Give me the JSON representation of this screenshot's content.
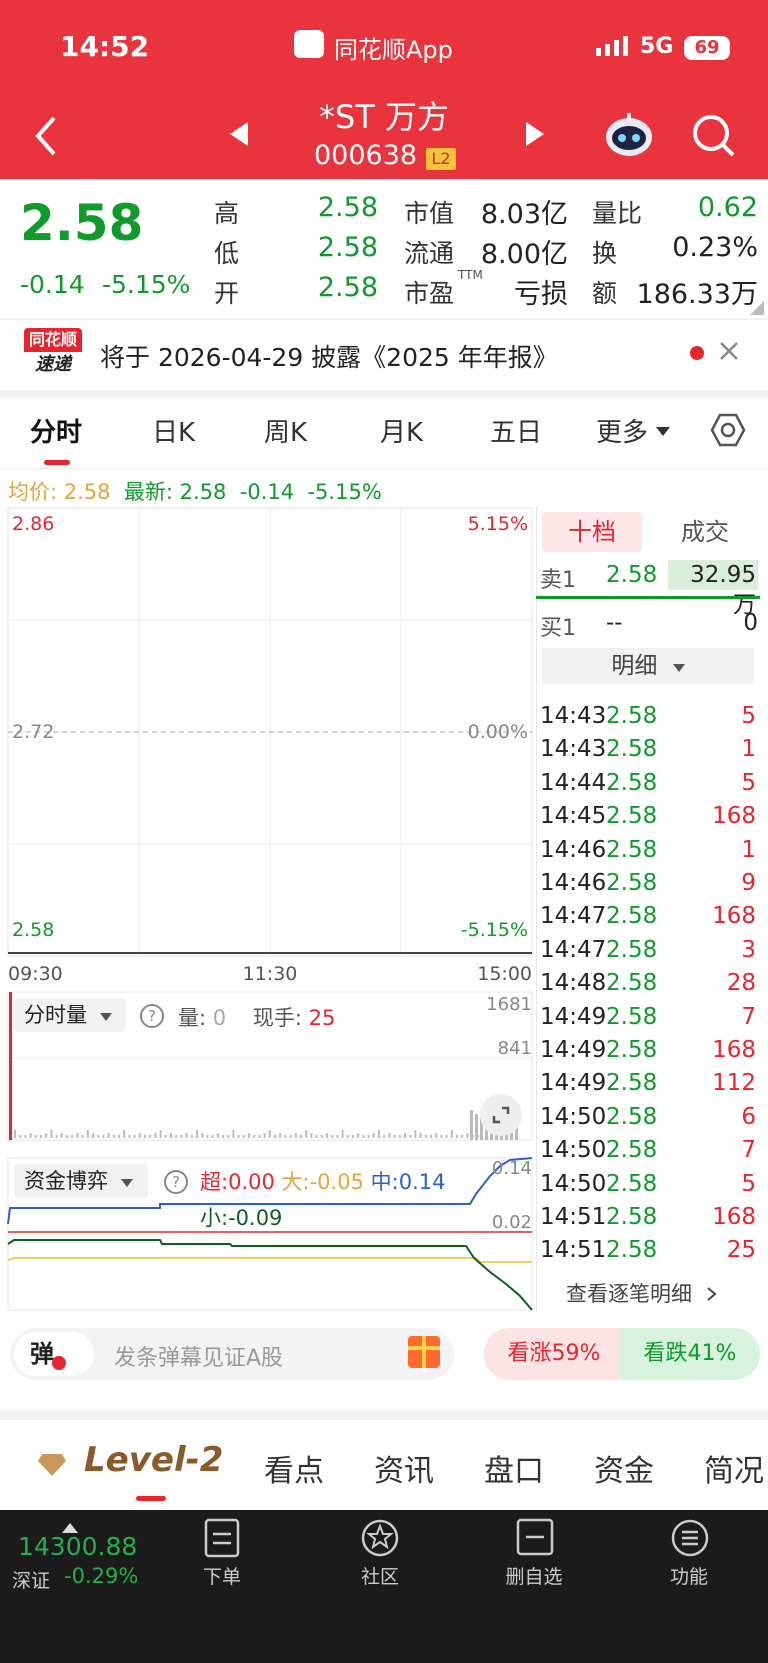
{
  "status_bar": {
    "time": "14:52",
    "app_name": "同花顺App",
    "network": "5G",
    "battery": "69"
  },
  "header": {
    "stock_name": "*ST 万方",
    "stock_code": "000638",
    "badge": "L2"
  },
  "quote": {
    "price": "2.58",
    "change": "-0.14",
    "change_pct": "-5.15%",
    "high_label": "高",
    "high": "2.58",
    "low_label": "低",
    "low": "2.58",
    "open_label": "开",
    "open": "2.58",
    "mcap_label": "市值",
    "mcap": "8.03亿",
    "float_label": "流通",
    "float_cap": "8.00亿",
    "pe_label": "市盈",
    "pe_sup": "TTM",
    "pe": "亏损",
    "vr_label": "量比",
    "vr": "0.62",
    "turnover_label": "换",
    "turnover": "0.23%",
    "amount_label": "额",
    "amount": "186.33万"
  },
  "notice": {
    "logo_top": "同花顺",
    "logo_bottom": "速递",
    "text": "将于 2026-04-29 披露《2025 年年报》"
  },
  "tabs": [
    "分时",
    "日K",
    "周K",
    "月K",
    "五日",
    "更多"
  ],
  "chart_header": {
    "avg_label": "均价:",
    "avg": "2.58",
    "latest_label": "最新:",
    "latest": "2.58",
    "chg": "-0.14",
    "chg_pct": "-5.15%"
  },
  "chart_data": [
    {
      "type": "line",
      "title": "分时",
      "y_ticks_left": [
        "2.86",
        "2.72",
        "2.58"
      ],
      "y_ticks_right": [
        "5.15%",
        "0.00%",
        "-5.15%"
      ],
      "x_ticks": [
        "09:30",
        "11:30",
        "15:00"
      ],
      "ylim": [
        2.58,
        2.86
      ],
      "prev_close": 2.72,
      "series": [
        {
          "values": [
            2.58,
            2.58
          ]
        }
      ]
    },
    {
      "type": "bar",
      "title": "分时量",
      "y_ticks": [
        "1681",
        "841"
      ],
      "vol_label": "量:",
      "vol": "0",
      "hand_label": "现手:",
      "hand": "25"
    },
    {
      "type": "line",
      "title": "资金博弈",
      "y_ticks": [
        "0.14",
        "0.02"
      ],
      "legend": [
        {
          "name": "超",
          "value": "0.00",
          "color": "#e5262f"
        },
        {
          "name": "大",
          "value": "-0.05",
          "color": "#e8a33b"
        },
        {
          "name": "中",
          "value": "0.14",
          "color": "#2a5fd0"
        },
        {
          "name": "小",
          "value": "-0.09",
          "color": "#0d5e20"
        }
      ]
    }
  ],
  "order_book": {
    "tab_active": "十档",
    "tab_other": "成交",
    "sell1_label": "卖1",
    "sell1_price": "2.58",
    "sell1_vol": "32.95万",
    "buy1_label": "买1",
    "buy1_price": "--",
    "buy1_vol": "0",
    "detail_label": "明细"
  },
  "trades": [
    {
      "time": "14:43",
      "price": "2.58",
      "vol": "5"
    },
    {
      "time": "14:43",
      "price": "2.58",
      "vol": "1"
    },
    {
      "time": "14:44",
      "price": "2.58",
      "vol": "5"
    },
    {
      "time": "14:45",
      "price": "2.58",
      "vol": "168"
    },
    {
      "time": "14:46",
      "price": "2.58",
      "vol": "1"
    },
    {
      "time": "14:46",
      "price": "2.58",
      "vol": "9"
    },
    {
      "time": "14:47",
      "price": "2.58",
      "vol": "168"
    },
    {
      "time": "14:47",
      "price": "2.58",
      "vol": "3"
    },
    {
      "time": "14:48",
      "price": "2.58",
      "vol": "28"
    },
    {
      "time": "14:49",
      "price": "2.58",
      "vol": "7"
    },
    {
      "time": "14:49",
      "price": "2.58",
      "vol": "168"
    },
    {
      "time": "14:49",
      "price": "2.58",
      "vol": "112"
    },
    {
      "time": "14:50",
      "price": "2.58",
      "vol": "6"
    },
    {
      "time": "14:50",
      "price": "2.58",
      "vol": "7"
    },
    {
      "time": "14:50",
      "price": "2.58",
      "vol": "5"
    },
    {
      "time": "14:51",
      "price": "2.58",
      "vol": "168"
    },
    {
      "time": "14:51",
      "price": "2.58",
      "vol": "25"
    }
  ],
  "trades_more": "查看逐笔明细",
  "danmu": {
    "icon": "弹",
    "placeholder": "发条弹幕见证A股",
    "up": "看涨59%",
    "down": "看跌41%"
  },
  "bottom_tabs": {
    "level2": "Level-2",
    "items": [
      "看点",
      "资讯",
      "盘口",
      "资金",
      "简况"
    ]
  },
  "nav": {
    "index_value": "14300.88",
    "index_name": "深证",
    "index_pct": "-0.29%",
    "items": [
      "下单",
      "社区",
      "删自选",
      "功能"
    ]
  }
}
